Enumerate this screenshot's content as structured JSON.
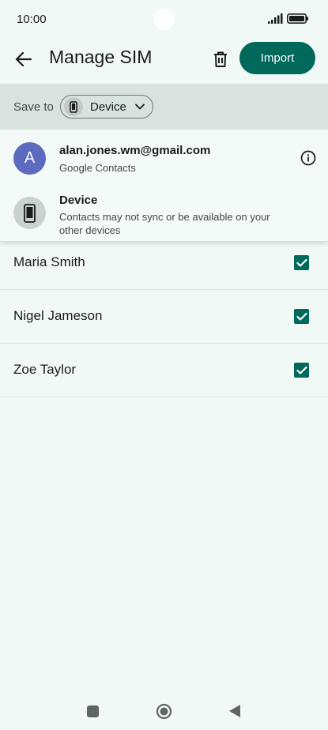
{
  "status_bar": {
    "time": "10:00"
  },
  "app_bar": {
    "title": "Manage SIM",
    "import_label": "Import"
  },
  "save_bar": {
    "label": "Save to",
    "selected_account": "Device"
  },
  "account_menu": {
    "items": [
      {
        "title": "alan.jones.wm@gmail.com",
        "subtitle": "Google Contacts",
        "avatar_letter": "A",
        "avatar_color": "#5c6bc0"
      },
      {
        "title": "Device",
        "subtitle": "Contacts may not sync or be available on your other devices",
        "icon": "smartphone-icon"
      }
    ]
  },
  "contacts": [
    {
      "name": "Maria Smith",
      "checked": true
    },
    {
      "name": "Nigel Jameson",
      "checked": true
    },
    {
      "name": "Zoe Taylor",
      "checked": true
    }
  ],
  "colors": {
    "accent": "#00695c",
    "background": "#f0f9f6",
    "save_bar_bg": "#d8e3df"
  }
}
